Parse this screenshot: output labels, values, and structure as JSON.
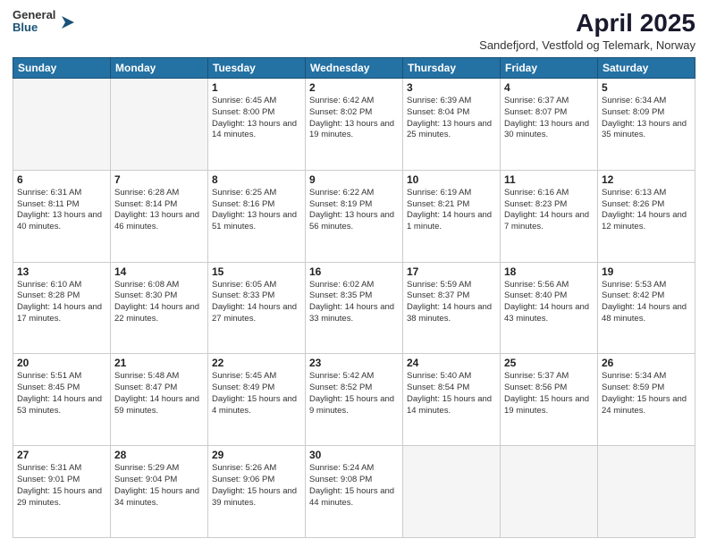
{
  "header": {
    "logo": {
      "line1": "General",
      "line2": "Blue"
    },
    "title": "April 2025",
    "location": "Sandefjord, Vestfold og Telemark, Norway"
  },
  "days_of_week": [
    "Sunday",
    "Monday",
    "Tuesday",
    "Wednesday",
    "Thursday",
    "Friday",
    "Saturday"
  ],
  "weeks": [
    [
      {
        "day": "",
        "info": ""
      },
      {
        "day": "",
        "info": ""
      },
      {
        "day": "1",
        "info": "Sunrise: 6:45 AM\nSunset: 8:00 PM\nDaylight: 13 hours\nand 14 minutes."
      },
      {
        "day": "2",
        "info": "Sunrise: 6:42 AM\nSunset: 8:02 PM\nDaylight: 13 hours\nand 19 minutes."
      },
      {
        "day": "3",
        "info": "Sunrise: 6:39 AM\nSunset: 8:04 PM\nDaylight: 13 hours\nand 25 minutes."
      },
      {
        "day": "4",
        "info": "Sunrise: 6:37 AM\nSunset: 8:07 PM\nDaylight: 13 hours\nand 30 minutes."
      },
      {
        "day": "5",
        "info": "Sunrise: 6:34 AM\nSunset: 8:09 PM\nDaylight: 13 hours\nand 35 minutes."
      }
    ],
    [
      {
        "day": "6",
        "info": "Sunrise: 6:31 AM\nSunset: 8:11 PM\nDaylight: 13 hours\nand 40 minutes."
      },
      {
        "day": "7",
        "info": "Sunrise: 6:28 AM\nSunset: 8:14 PM\nDaylight: 13 hours\nand 46 minutes."
      },
      {
        "day": "8",
        "info": "Sunrise: 6:25 AM\nSunset: 8:16 PM\nDaylight: 13 hours\nand 51 minutes."
      },
      {
        "day": "9",
        "info": "Sunrise: 6:22 AM\nSunset: 8:19 PM\nDaylight: 13 hours\nand 56 minutes."
      },
      {
        "day": "10",
        "info": "Sunrise: 6:19 AM\nSunset: 8:21 PM\nDaylight: 14 hours\nand 1 minute."
      },
      {
        "day": "11",
        "info": "Sunrise: 6:16 AM\nSunset: 8:23 PM\nDaylight: 14 hours\nand 7 minutes."
      },
      {
        "day": "12",
        "info": "Sunrise: 6:13 AM\nSunset: 8:26 PM\nDaylight: 14 hours\nand 12 minutes."
      }
    ],
    [
      {
        "day": "13",
        "info": "Sunrise: 6:10 AM\nSunset: 8:28 PM\nDaylight: 14 hours\nand 17 minutes."
      },
      {
        "day": "14",
        "info": "Sunrise: 6:08 AM\nSunset: 8:30 PM\nDaylight: 14 hours\nand 22 minutes."
      },
      {
        "day": "15",
        "info": "Sunrise: 6:05 AM\nSunset: 8:33 PM\nDaylight: 14 hours\nand 27 minutes."
      },
      {
        "day": "16",
        "info": "Sunrise: 6:02 AM\nSunset: 8:35 PM\nDaylight: 14 hours\nand 33 minutes."
      },
      {
        "day": "17",
        "info": "Sunrise: 5:59 AM\nSunset: 8:37 PM\nDaylight: 14 hours\nand 38 minutes."
      },
      {
        "day": "18",
        "info": "Sunrise: 5:56 AM\nSunset: 8:40 PM\nDaylight: 14 hours\nand 43 minutes."
      },
      {
        "day": "19",
        "info": "Sunrise: 5:53 AM\nSunset: 8:42 PM\nDaylight: 14 hours\nand 48 minutes."
      }
    ],
    [
      {
        "day": "20",
        "info": "Sunrise: 5:51 AM\nSunset: 8:45 PM\nDaylight: 14 hours\nand 53 minutes."
      },
      {
        "day": "21",
        "info": "Sunrise: 5:48 AM\nSunset: 8:47 PM\nDaylight: 14 hours\nand 59 minutes."
      },
      {
        "day": "22",
        "info": "Sunrise: 5:45 AM\nSunset: 8:49 PM\nDaylight: 15 hours\nand 4 minutes."
      },
      {
        "day": "23",
        "info": "Sunrise: 5:42 AM\nSunset: 8:52 PM\nDaylight: 15 hours\nand 9 minutes."
      },
      {
        "day": "24",
        "info": "Sunrise: 5:40 AM\nSunset: 8:54 PM\nDaylight: 15 hours\nand 14 minutes."
      },
      {
        "day": "25",
        "info": "Sunrise: 5:37 AM\nSunset: 8:56 PM\nDaylight: 15 hours\nand 19 minutes."
      },
      {
        "day": "26",
        "info": "Sunrise: 5:34 AM\nSunset: 8:59 PM\nDaylight: 15 hours\nand 24 minutes."
      }
    ],
    [
      {
        "day": "27",
        "info": "Sunrise: 5:31 AM\nSunset: 9:01 PM\nDaylight: 15 hours\nand 29 minutes."
      },
      {
        "day": "28",
        "info": "Sunrise: 5:29 AM\nSunset: 9:04 PM\nDaylight: 15 hours\nand 34 minutes."
      },
      {
        "day": "29",
        "info": "Sunrise: 5:26 AM\nSunset: 9:06 PM\nDaylight: 15 hours\nand 39 minutes."
      },
      {
        "day": "30",
        "info": "Sunrise: 5:24 AM\nSunset: 9:08 PM\nDaylight: 15 hours\nand 44 minutes."
      },
      {
        "day": "",
        "info": ""
      },
      {
        "day": "",
        "info": ""
      },
      {
        "day": "",
        "info": ""
      }
    ]
  ]
}
